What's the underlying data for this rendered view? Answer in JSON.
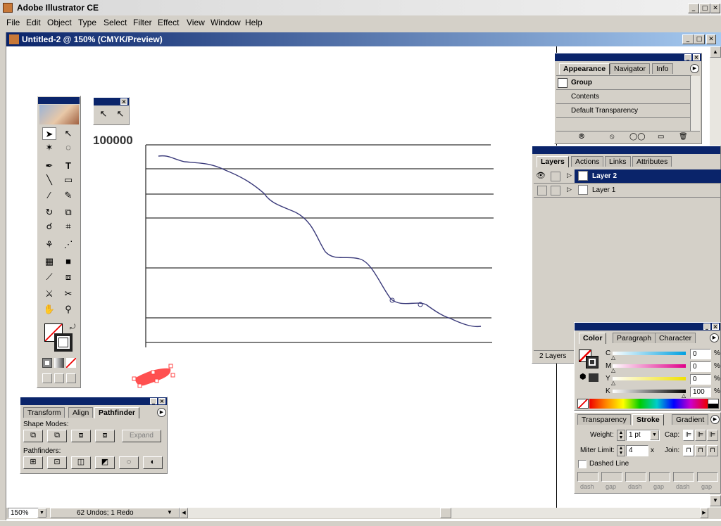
{
  "app": {
    "title": "Adobe Illustrator CE"
  },
  "menu": [
    "File",
    "Edit",
    "Object",
    "Type",
    "Select",
    "Filter",
    "Effect",
    "View",
    "Window",
    "Help"
  ],
  "document": {
    "title": "Untitled-2 @ 150% (CMYK/Preview)"
  },
  "canvas": {
    "label": "100000"
  },
  "appearance": {
    "tabs": [
      "Appearance",
      "Navigator",
      "Info"
    ],
    "rows": [
      "Group",
      "Contents",
      "Default Transparency"
    ]
  },
  "layers": {
    "tabs": [
      "Layers",
      "Actions",
      "Links",
      "Attributes"
    ],
    "items": [
      "Layer 2",
      "Layer 1"
    ],
    "footer": "2 Layers"
  },
  "color": {
    "tabs": [
      "Color",
      "Paragraph",
      "Character"
    ],
    "channels": [
      {
        "name": "C",
        "value": "0"
      },
      {
        "name": "M",
        "value": "0"
      },
      {
        "name": "Y",
        "value": "0"
      },
      {
        "name": "K",
        "value": "100"
      }
    ],
    "unit": "%"
  },
  "stroke": {
    "tabs": [
      "Transparency",
      "Stroke",
      "Gradient"
    ],
    "weight_label": "Weight:",
    "weight": "1 pt",
    "cap_label": "Cap:",
    "miter_label": "Miter Limit:",
    "miter": "4",
    "miter_unit": "x",
    "join_label": "Join:",
    "dashed_label": "Dashed Line",
    "dash_labels": [
      "dash",
      "gap",
      "dash",
      "gap",
      "dash",
      "gap"
    ]
  },
  "pathfinder": {
    "tabs": [
      "Transform",
      "Align",
      "Pathfinder"
    ],
    "shape_modes_label": "Shape Modes:",
    "expand_label": "Expand",
    "pathfinders_label": "Pathfinders:"
  },
  "status": {
    "zoom": "150%",
    "undos": "62 Undos; 1 Redo"
  },
  "colors": {
    "titlebar": "#0a246a",
    "accent": "#ff4444",
    "curve": "#3a3a7a"
  }
}
